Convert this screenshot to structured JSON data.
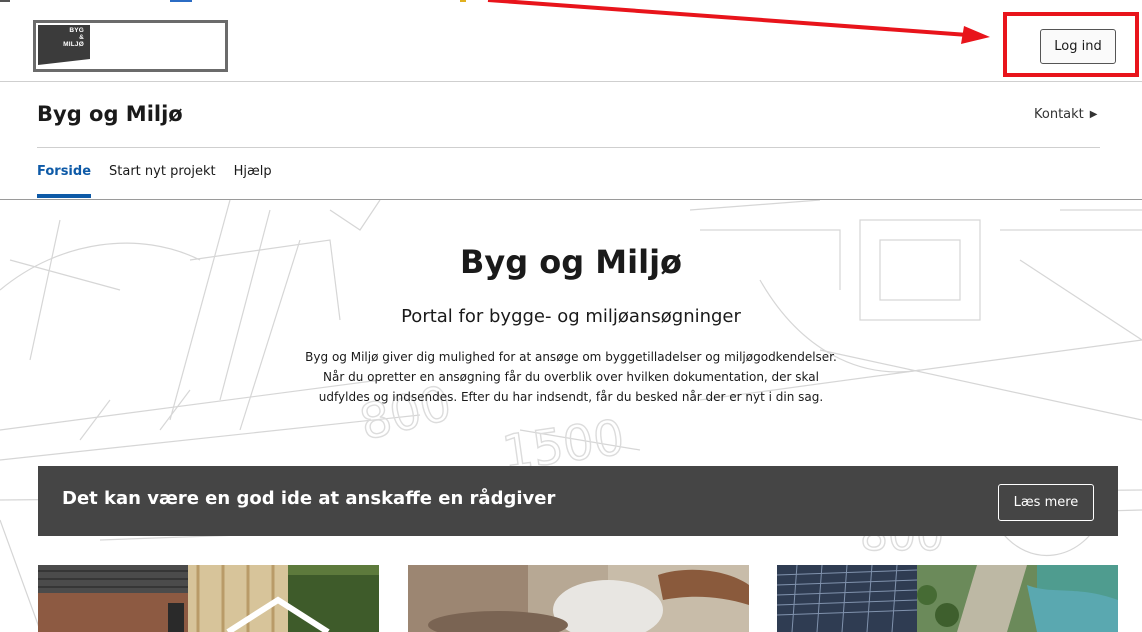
{
  "header": {
    "logo_text": [
      "BYG",
      "&",
      "MILJØ"
    ],
    "login_label": "Log ind"
  },
  "site": {
    "title": "Byg og Miljø",
    "contact_label": "Kontakt"
  },
  "nav": {
    "items": [
      {
        "label": "Forside",
        "active": true
      },
      {
        "label": "Start nyt projekt",
        "active": false
      },
      {
        "label": "Hjælp",
        "active": false
      }
    ]
  },
  "hero": {
    "title": "Byg og Miljø",
    "subtitle": "Portal for bygge- og miljøansøgninger",
    "text_lines": [
      "Byg og Miljø giver dig mulighed for at ansøge om byggetilladelser og miljøgodkendelser.",
      "Når du opretter en ansøgning får du overblik over hvilken dokumentation, der skal",
      "udfyldes og indsendes. Efter du har indsendt, får du besked når der er nyt i din sag."
    ]
  },
  "banner": {
    "text": "Det kan være en god ide at anskaffe en rådgiver",
    "button_label": "Læs mere"
  },
  "colors": {
    "accent": "#0e5aa7",
    "banner_bg": "#454545",
    "annotation_red": "#e8141b"
  },
  "icons": {
    "contact": "triangle-right-icon"
  }
}
